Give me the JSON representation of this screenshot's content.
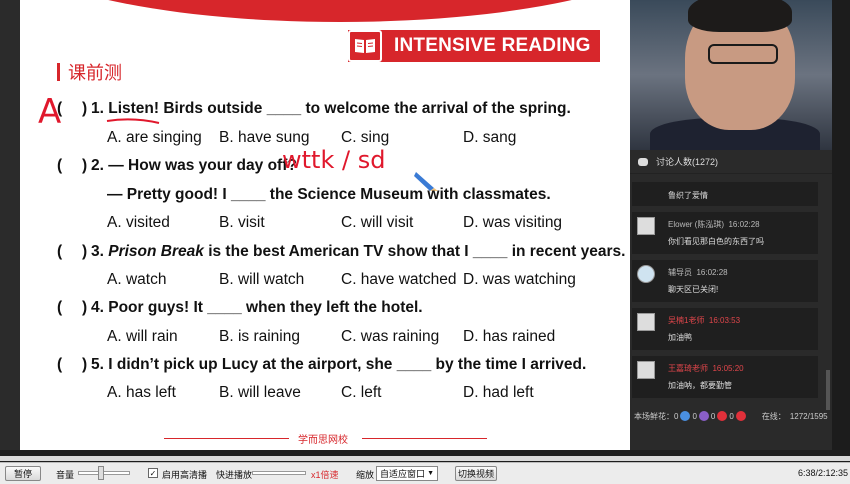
{
  "banner": {
    "title": "INTENSIVE READING",
    "icon": "book-icon"
  },
  "section_label": "课前测",
  "questions": [
    {
      "paren_open": "(",
      "paren_close": ")",
      "text": "1. Listen! Birds outside ____ to welcome the arrival of the spring.",
      "options": [
        "A. are singing",
        "B. have sung",
        "C. sing",
        "D. sang"
      ],
      "handwritten": "A"
    },
    {
      "paren_open": "(",
      "paren_close": ")",
      "text": "2. — How was your day off?",
      "text2": "— Pretty good! I ____ the Science Museum with classmates.",
      "options": [
        "A. visited",
        "B. visit",
        "C. will visit",
        "D. was visiting"
      ],
      "handwritten": "wttk / sd"
    },
    {
      "paren_open": "(",
      "paren_close": ")",
      "number": "3.",
      "italic": "Prison Break",
      "text_rest": "is the best American TV show that I ____ in recent years.",
      "options": [
        "A. watch",
        "B. will watch",
        "C. have watched",
        "D. was watching"
      ]
    },
    {
      "paren_open": "(",
      "paren_close": ")",
      "text": "4. Poor guys! It ____ when they left the hotel.",
      "options": [
        "A. will rain",
        "B. is raining",
        "C. was raining",
        "D. has rained"
      ]
    },
    {
      "paren_open": "(",
      "paren_close": ")",
      "text": "5. I didn’t pick up Lucy at the airport, she ____ by the time I arrived.",
      "options": [
        "A. has left",
        "B. will leave",
        "C. left",
        "D. had left"
      ]
    }
  ],
  "footer_text": "学而思网校",
  "chat": {
    "header": "讨论人数(1272)",
    "messages": [
      {
        "name": "",
        "time": "",
        "text": "鲁织了爱情"
      },
      {
        "name": "Elower (陈泓琪)",
        "time": "16:02:28",
        "text": "你们看见那白色的东西了吗",
        "teacher": false
      },
      {
        "name": "辅导员",
        "time": "16:02:28",
        "text": "聊天区已关闭!",
        "teacher": false
      },
      {
        "name": "吴楠1老师",
        "time": "16:03:53",
        "text": "加油鸭",
        "teacher": true
      },
      {
        "name": "王嘉琦老师",
        "time": "16:05:20",
        "text": "加油呐，都要勤管",
        "teacher": true
      }
    ],
    "footer_label": "本场鲜花：",
    "flower_counts": [
      "0",
      "0",
      "0",
      "0"
    ],
    "online_label": "在线：",
    "online_count": "1272/1595"
  },
  "toolbar": {
    "pause": "暂停",
    "volume": "音量",
    "hd_label": "启用高清播",
    "forward_label": "快进播放",
    "speed": "x1倍速",
    "zoom_label": "缩放",
    "zoom_value": "自适应窗口",
    "switch_video": "切换视频",
    "time": "6:38/2:12:35"
  }
}
